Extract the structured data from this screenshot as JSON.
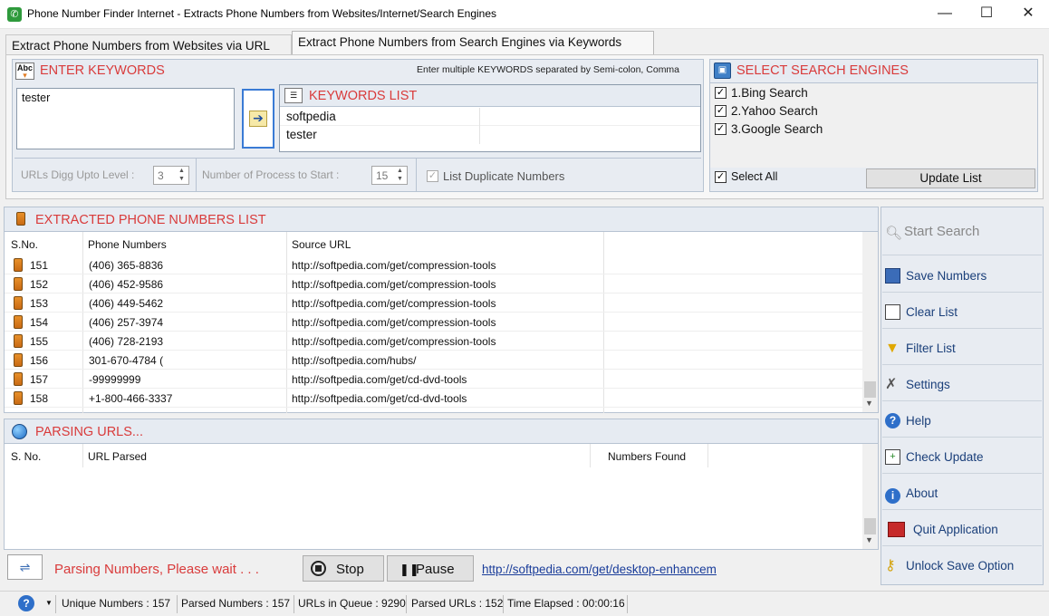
{
  "window": {
    "title": "Phone Number Finder Internet - Extracts Phone Numbers from Websites/Internet/Search Engines",
    "minimize": "—",
    "maximize": "☐",
    "close": "✕"
  },
  "tabs": [
    {
      "label": "Extract Phone Numbers from Websites via URL",
      "active": false
    },
    {
      "label": "Extract Phone Numbers from Search Engines via Keywords",
      "active": true
    }
  ],
  "keywords": {
    "header": "ENTER KEYWORDS",
    "hint": "Enter multiple KEYWORDS separated by Semi-colon, Comma",
    "input_value": "tester",
    "list_header": "KEYWORDS LIST",
    "list": [
      "softpedia",
      "tester"
    ]
  },
  "options": {
    "digg_label": "URLs Digg Upto Level :",
    "digg_value": "3",
    "process_label": "Number of Process to Start :",
    "process_value": "15",
    "duplicates_label": "List Duplicate Numbers"
  },
  "engines": {
    "header": "SELECT SEARCH ENGINES",
    "items": [
      {
        "label": "1.Bing Search",
        "checked": true
      },
      {
        "label": "2.Yahoo Search",
        "checked": true
      },
      {
        "label": "3.Google Search",
        "checked": true
      }
    ],
    "select_all": "Select All",
    "update_button": "Update List"
  },
  "extracted": {
    "header": "EXTRACTED PHONE NUMBERS LIST",
    "columns": [
      "S.No.",
      "Phone Numbers",
      "Source URL"
    ],
    "rows": [
      {
        "sno": "151",
        "phone": "(406) 365-8836",
        "url": "http://softpedia.com/get/compression-tools"
      },
      {
        "sno": "152",
        "phone": "(406) 452-9586",
        "url": "http://softpedia.com/get/compression-tools"
      },
      {
        "sno": "153",
        "phone": "(406) 449-5462",
        "url": "http://softpedia.com/get/compression-tools"
      },
      {
        "sno": "154",
        "phone": "(406) 257-3974",
        "url": "http://softpedia.com/get/compression-tools"
      },
      {
        "sno": "155",
        "phone": "(406) 728-2193",
        "url": "http://softpedia.com/get/compression-tools"
      },
      {
        "sno": "156",
        "phone": "301-670-4784 (",
        "url": "http://softpedia.com/hubs/"
      },
      {
        "sno": "157",
        "phone": "-99999999",
        "url": "http://softpedia.com/get/cd-dvd-tools"
      },
      {
        "sno": "158",
        "phone": "+1-800-466-3337",
        "url": "http://softpedia.com/get/cd-dvd-tools"
      }
    ]
  },
  "parsing": {
    "header": "PARSING URLS...",
    "columns": [
      "S. No.",
      "URL Parsed",
      "Numbers Found"
    ]
  },
  "bottom": {
    "status_text": "Parsing Numbers, Please wait . . .",
    "stop_button": "Stop",
    "pause_button": "Pause",
    "link": "http://softpedia.com/get/desktop-enhancem"
  },
  "sidebar": [
    {
      "label": "Start Search",
      "icon": "search-icon"
    },
    {
      "label": "Save Numbers",
      "icon": "save-icon"
    },
    {
      "label": "Clear List",
      "icon": "clear-icon"
    },
    {
      "label": "Filter List",
      "icon": "filter-icon"
    },
    {
      "label": "Settings",
      "icon": "settings-icon"
    },
    {
      "label": "Help",
      "icon": "help-icon"
    },
    {
      "label": "Check Update",
      "icon": "update-icon"
    },
    {
      "label": "About",
      "icon": "about-icon"
    },
    {
      "label": "Quit Application",
      "icon": "quit-icon"
    },
    {
      "label": "Unlock Save Option",
      "icon": "key-icon"
    }
  ],
  "statusbar": {
    "unique": "Unique Numbers : 157",
    "parsed": "Parsed Numbers : 157",
    "queue": "URLs in Queue : 9290",
    "parsed_urls": "Parsed URLs : 152",
    "elapsed": "Time Elapsed : 00:00:16"
  },
  "colors": {
    "accent_red": "#d93b3b",
    "panel_bg": "#e8ecf2",
    "link_blue": "#1a3d9a"
  }
}
